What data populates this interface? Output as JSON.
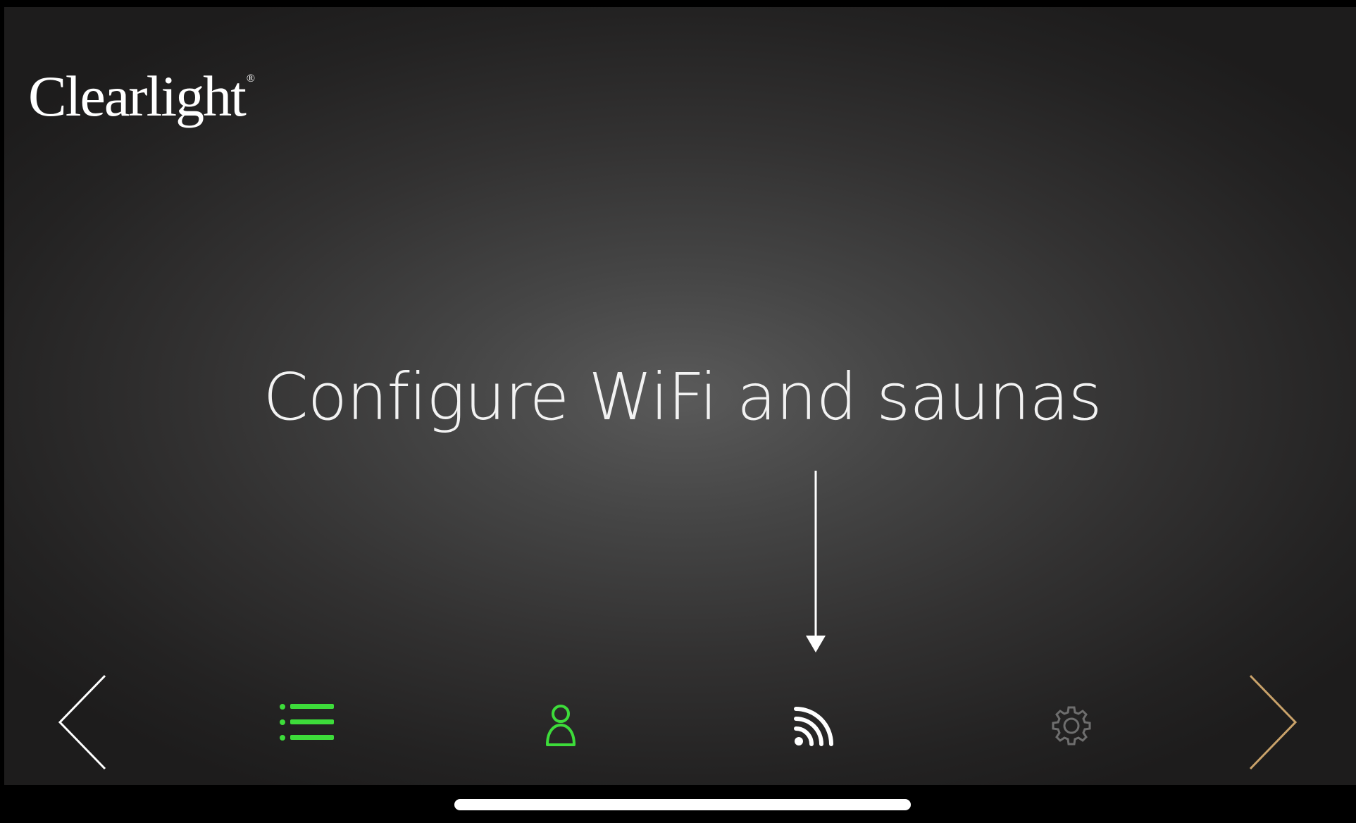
{
  "brand": {
    "logo_text": "Clearlight",
    "registered_mark": "®"
  },
  "tutorial": {
    "caption": "Configure WiFi and saunas",
    "pointer": "arrow-down-icon"
  },
  "bottom_nav": {
    "prev": {
      "icon": "chevron-left-icon",
      "color": "#ffffff"
    },
    "items": [
      {
        "icon": "list-icon",
        "color": "#3ddc3a"
      },
      {
        "icon": "user-icon",
        "color": "#3ddc3a"
      },
      {
        "icon": "wifi-icon",
        "color": "#ffffff"
      },
      {
        "icon": "gear-icon",
        "color": "#6e6e6e"
      }
    ],
    "next": {
      "icon": "chevron-right-icon",
      "color": "#c9a26a"
    }
  },
  "colors": {
    "accent_green": "#3ddc3a",
    "accent_gold": "#c9a26a",
    "text": "#ffffff"
  }
}
